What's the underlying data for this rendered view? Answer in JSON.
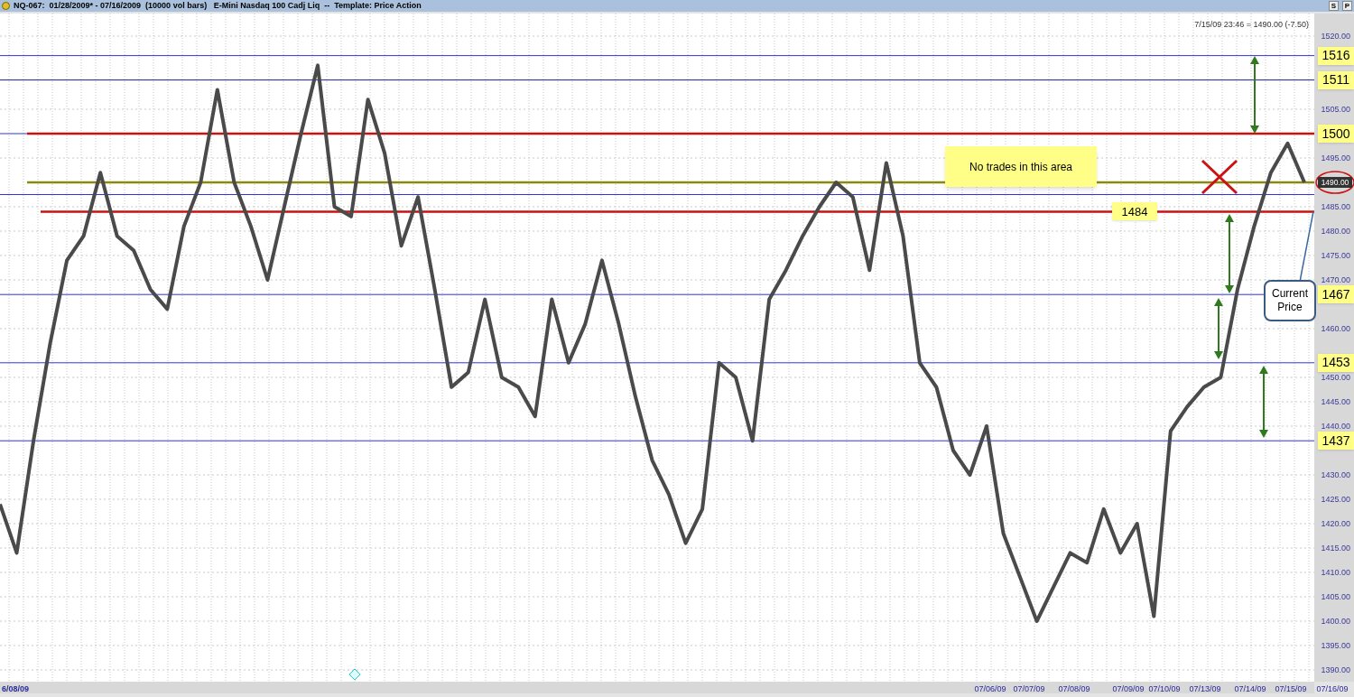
{
  "title_bar": {
    "title": "NQ-067:  01/28/2009* - 07/16/2009  (10000 vol bars)   E-Mini Nasdaq 100 Cadj Liq  --  Template: Price Action",
    "buttons": [
      "S",
      "P"
    ]
  },
  "chart": {
    "readout": "7/15/09 23:46 = 1490.00 (-7.50)",
    "last_price": "1490.00",
    "notes": [
      {
        "kind": "box",
        "text": "No trades in this area"
      },
      {
        "kind": "callout",
        "text": "Current Price"
      }
    ],
    "level_labels": [
      {
        "text": "1516",
        "kind": "axis"
      },
      {
        "text": "1511",
        "kind": "axis"
      },
      {
        "text": "1500",
        "kind": "axis"
      },
      {
        "text": "1484",
        "kind": "inline"
      },
      {
        "text": "1467",
        "kind": "axis"
      },
      {
        "text": "1453",
        "kind": "axis"
      },
      {
        "text": "1437",
        "kind": "axis"
      }
    ],
    "time_axis": [
      "6/08/09",
      "07/06/09",
      "07/07/09",
      "07/08/09",
      "07/09/09",
      "07/10/09",
      "07/13/09",
      "07/14/09",
      "07/15/09",
      "07/16/09"
    ],
    "chart_data": {
      "type": "line",
      "grid": true,
      "series": [
        {
          "color": "#4a4a4a",
          "values": [
            1424,
            1414,
            1437,
            1457,
            1474,
            1479,
            1492,
            1479,
            1476,
            1468,
            1464,
            1481,
            1490,
            1509,
            1490,
            1481,
            1470,
            1485,
            1500,
            1514,
            1485,
            1483,
            1507,
            1496,
            1477,
            1487,
            1468,
            1448,
            1451,
            1466,
            1450,
            1448,
            1442,
            1466,
            1453,
            1461,
            1474,
            1461,
            1446,
            1433,
            1426,
            1416,
            1423,
            1453,
            1450,
            1437,
            1466,
            1472,
            1479,
            1485,
            1490,
            1487,
            1472,
            1494,
            1479,
            1453,
            1448,
            1435,
            1430,
            1440,
            1418,
            1409,
            1400,
            1407,
            1414,
            1412,
            1423,
            1414,
            1420,
            1401,
            1439,
            1444,
            1448,
            1450,
            1468,
            1481,
            1492,
            1498,
            1490
          ]
        }
      ],
      "ylim": [
        1390,
        1520
      ],
      "yticks": [
        {
          "value": 1520,
          "label": "1520.00"
        },
        {
          "value": 1505,
          "label": "1505.00"
        },
        {
          "value": 1495,
          "label": "1495.00"
        },
        {
          "value": 1485,
          "label": "1485.00"
        },
        {
          "value": 1480,
          "label": "1480.00"
        },
        {
          "value": 1475,
          "label": "1475.00"
        },
        {
          "value": 1470,
          "label": "1470.00"
        },
        {
          "value": 1460,
          "label": "1460.00"
        },
        {
          "value": 1450,
          "label": "1450.00"
        },
        {
          "value": 1445,
          "label": "1445.00"
        },
        {
          "value": 1440,
          "label": "1440.00"
        },
        {
          "value": 1430,
          "label": "1430.00"
        },
        {
          "value": 1425,
          "label": "1425.00"
        },
        {
          "value": 1420,
          "label": "1420.00"
        },
        {
          "value": 1415,
          "label": "1415.00"
        },
        {
          "value": 1410,
          "label": "1410.00"
        },
        {
          "value": 1405,
          "label": "1405.00"
        },
        {
          "value": 1400,
          "label": "1400.00"
        },
        {
          "value": 1395,
          "label": "1395.00"
        },
        {
          "value": 1390,
          "label": "1390.00"
        }
      ],
      "ref_lines": [
        {
          "axis": "y",
          "value": 1516,
          "color": "#3333dd"
        },
        {
          "axis": "y",
          "value": 1511,
          "color": "#22228a"
        },
        {
          "axis": "y",
          "value": 1500,
          "color": "#3333dd"
        },
        {
          "axis": "y",
          "value": 1500,
          "color": "#cc1111"
        },
        {
          "axis": "y",
          "value": 1490,
          "color": "#8a8a10"
        },
        {
          "axis": "y",
          "value": 1487.5,
          "color": "#3333dd"
        },
        {
          "axis": "y",
          "value": 1484,
          "color": "#cc1111"
        },
        {
          "axis": "y",
          "value": 1467,
          "color": "#3333dd"
        },
        {
          "axis": "y",
          "value": 1453,
          "color": "#3333dd"
        },
        {
          "axis": "y",
          "value": 1437,
          "color": "#3333dd"
        }
      ]
    }
  }
}
